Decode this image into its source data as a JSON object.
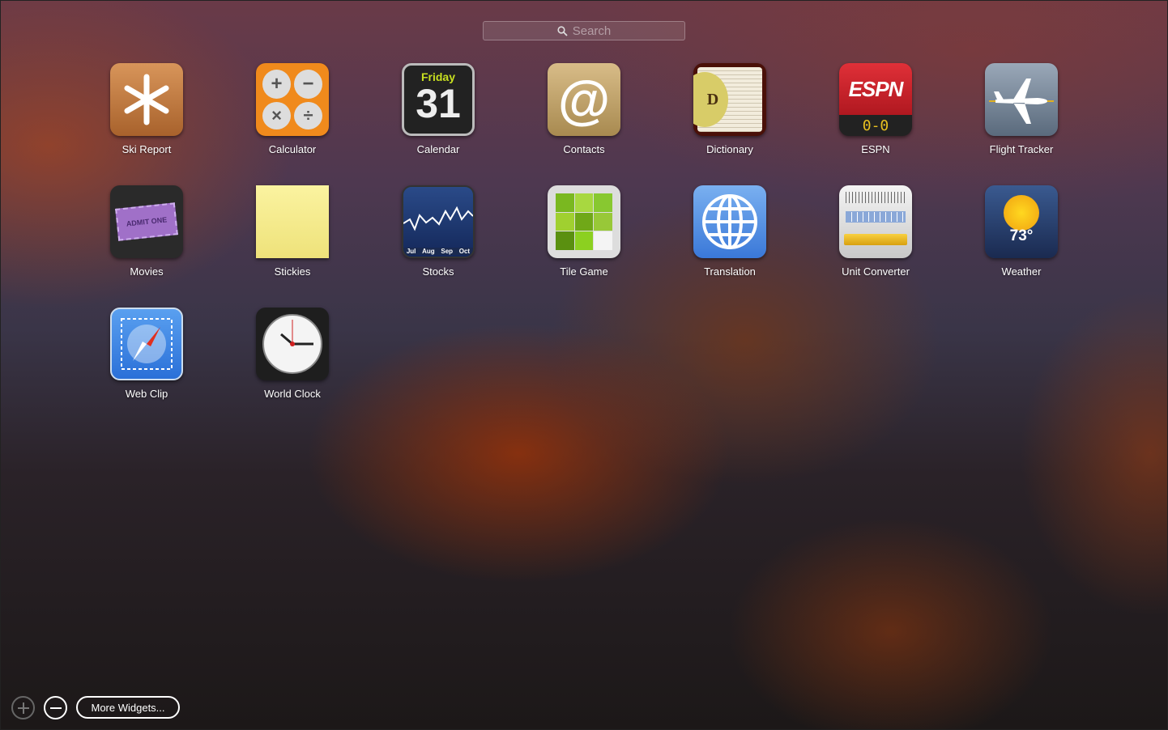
{
  "search": {
    "placeholder": "Search",
    "icon": "magnifier-icon"
  },
  "widgets": [
    {
      "label": "Ski Report",
      "icon": "snowflake-icon"
    },
    {
      "label": "Calculator",
      "icon": "calculator-icon",
      "symbols": [
        "+",
        "−",
        "×",
        "÷"
      ]
    },
    {
      "label": "Calendar",
      "icon": "calendar-icon",
      "day": "Friday",
      "date": "31"
    },
    {
      "label": "Contacts",
      "icon": "at-sign-icon",
      "symbol": "@"
    },
    {
      "label": "Dictionary",
      "icon": "dictionary-icon",
      "letter": "D"
    },
    {
      "label": "ESPN",
      "icon": "espn-icon",
      "logo": "ESPN",
      "score": "0-0"
    },
    {
      "label": "Flight Tracker",
      "icon": "airplane-icon"
    },
    {
      "label": "Movies",
      "icon": "ticket-icon",
      "ticket": "ADMIT ONE"
    },
    {
      "label": "Stickies",
      "icon": "sticky-note-icon"
    },
    {
      "label": "Stocks",
      "icon": "stock-chart-icon",
      "months": [
        "Jul",
        "Aug",
        "Sep",
        "Oct"
      ]
    },
    {
      "label": "Tile Game",
      "icon": "tile-grid-icon"
    },
    {
      "label": "Translation",
      "icon": "globe-icon"
    },
    {
      "label": "Unit Converter",
      "icon": "ruler-icon"
    },
    {
      "label": "Weather",
      "icon": "sun-icon",
      "temp": "73°"
    },
    {
      "label": "Web Clip",
      "icon": "compass-icon"
    },
    {
      "label": "World Clock",
      "icon": "clock-icon"
    }
  ],
  "bottom": {
    "add_icon": "plus-icon",
    "remove_icon": "minus-icon",
    "more_label": "More Widgets..."
  },
  "colors": {
    "accent_calendar": "#c8e020",
    "espn_red": "#c8202a",
    "sticky": "#f6ec8a"
  }
}
